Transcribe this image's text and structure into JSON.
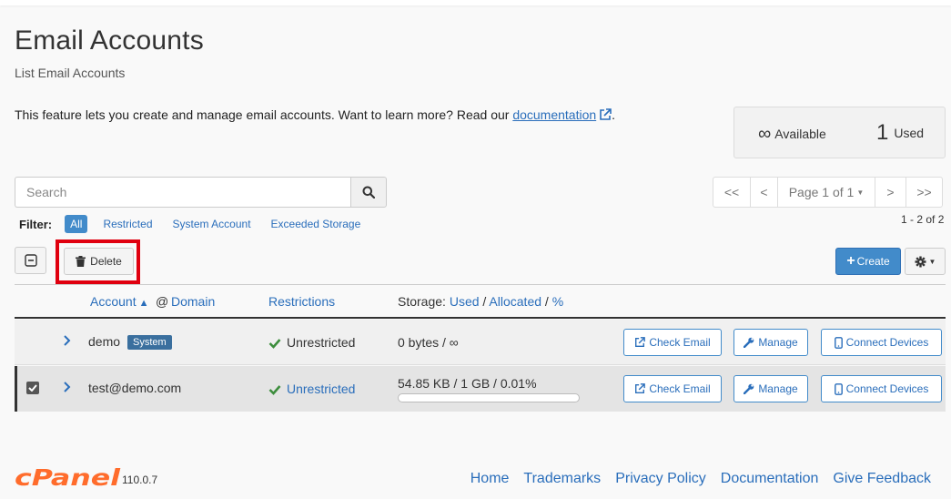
{
  "header": {
    "title": "Email Accounts",
    "subtitle": "List Email Accounts"
  },
  "intro": {
    "text": "This feature lets you create and manage email accounts. Want to learn more? Read our ",
    "link": "documentation",
    "suffix": "."
  },
  "stats": {
    "available_value": "∞",
    "available_label": "Available",
    "used_value": "1",
    "used_label": "Used"
  },
  "search": {
    "placeholder": "Search"
  },
  "pagination": {
    "first": "<<",
    "prev": "<",
    "page_label": "Page 1 of 1",
    "next": ">",
    "last": ">>",
    "range": "1 - 2 of 2"
  },
  "filter": {
    "label": "Filter:",
    "options": [
      "All",
      "Restricted",
      "System Account",
      "Exceeded Storage"
    ]
  },
  "toolbar": {
    "delete_label": "Delete",
    "create_label": "Create"
  },
  "table": {
    "headers": {
      "account": "Account",
      "at": "@",
      "domain": "Domain",
      "restrictions": "Restrictions",
      "storage_prefix": "Storage:",
      "used": "Used",
      "slash1": "/",
      "allocated": "Allocated",
      "slash2": "/",
      "percent": "%"
    },
    "rows": [
      {
        "account": "demo",
        "badge": "System",
        "restriction": "Unrestricted",
        "storage": "0 bytes / ∞",
        "selected": false
      },
      {
        "account": "test@demo.com",
        "badge": "",
        "restriction": "Unrestricted",
        "storage": "54.85 KB / 1 GB / 0.01%",
        "usage_fraction": 0.0001,
        "selected": true
      }
    ],
    "actions": {
      "check_email": "Check Email",
      "manage": "Manage",
      "connect_devices": "Connect Devices"
    }
  },
  "footer": {
    "logo": "cPanel",
    "version": "110.0.7",
    "links": [
      "Home",
      "Trademarks",
      "Privacy Policy",
      "Documentation",
      "Give Feedback"
    ]
  },
  "colors": {
    "accent": "#428bca",
    "link": "#2a6ebb",
    "logo": "#ff6c2c",
    "success": "#3c8d3c",
    "highlight": "#e0000f"
  }
}
